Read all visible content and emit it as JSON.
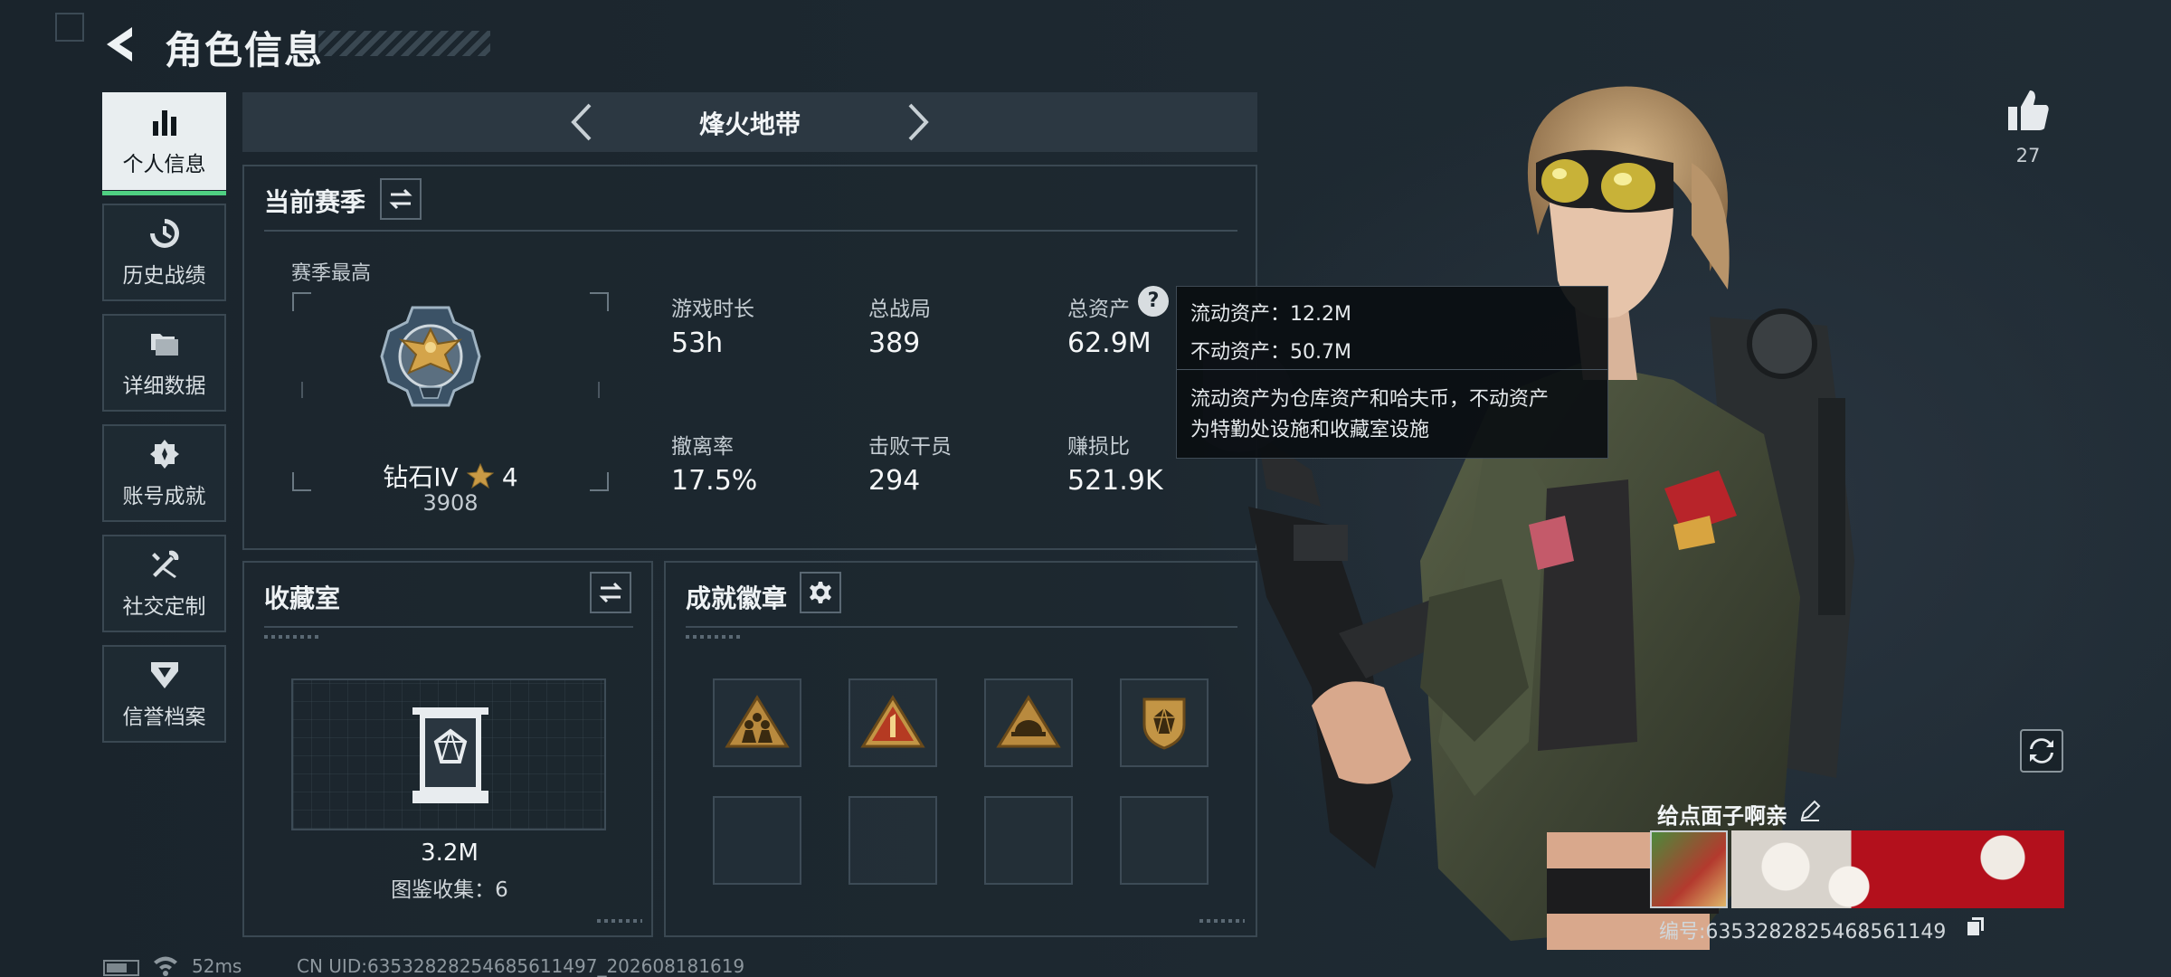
{
  "header": {
    "title": "角色信息"
  },
  "nav": {
    "items": [
      {
        "label": "个人信息",
        "icon": "bar-chart-icon",
        "active": true
      },
      {
        "label": "历史战绩",
        "icon": "history-icon"
      },
      {
        "label": "详细数据",
        "icon": "folders-icon"
      },
      {
        "label": "账号成就",
        "icon": "achievement-icon"
      },
      {
        "label": "社交定制",
        "icon": "tools-icon"
      },
      {
        "label": "信誉档案",
        "icon": "reputation-icon"
      }
    ]
  },
  "mode": {
    "name": "烽火地带"
  },
  "season": {
    "title": "当前赛季",
    "best_label": "赛季最高",
    "rank": "钻石IV",
    "stars": "4",
    "score": "3908",
    "stats": [
      {
        "label": "游戏时长",
        "value": "53h"
      },
      {
        "label": "总战局",
        "value": "389"
      },
      {
        "label": "总资产",
        "value": "62.9M"
      },
      {
        "label": "撤离率",
        "value": "17.5%"
      },
      {
        "label": "击败干员",
        "value": "294"
      },
      {
        "label": "赚损比",
        "value": "521.9K"
      }
    ]
  },
  "tooltip": {
    "liquid": "流动资产：12.2M",
    "fixed": "不动资产：50.7M",
    "desc_line1": "流动资产为仓库资产和哈夫币，不动资产",
    "desc_line2": "为特勤处设施和收藏室设施"
  },
  "collection": {
    "title": "收藏室",
    "value": "3.2M",
    "count_text": "图鉴收集：6"
  },
  "badges": {
    "title": "成就徽章",
    "items": [
      "squad-badge-icon",
      "rank-one-badge-icon",
      "helmet-badge-icon",
      "diamond-shield-badge-icon"
    ]
  },
  "player": {
    "likes": "27",
    "name": "给点面子啊亲",
    "id_text": "编号:6353282825468561149"
  },
  "status": {
    "ping": "52ms",
    "uid": "CN UID:6353282825468561149​7_202608181619"
  },
  "colors": {
    "accent_green": "#4fd082",
    "gold": "#c99a45",
    "panel_border": "#3a4852"
  }
}
